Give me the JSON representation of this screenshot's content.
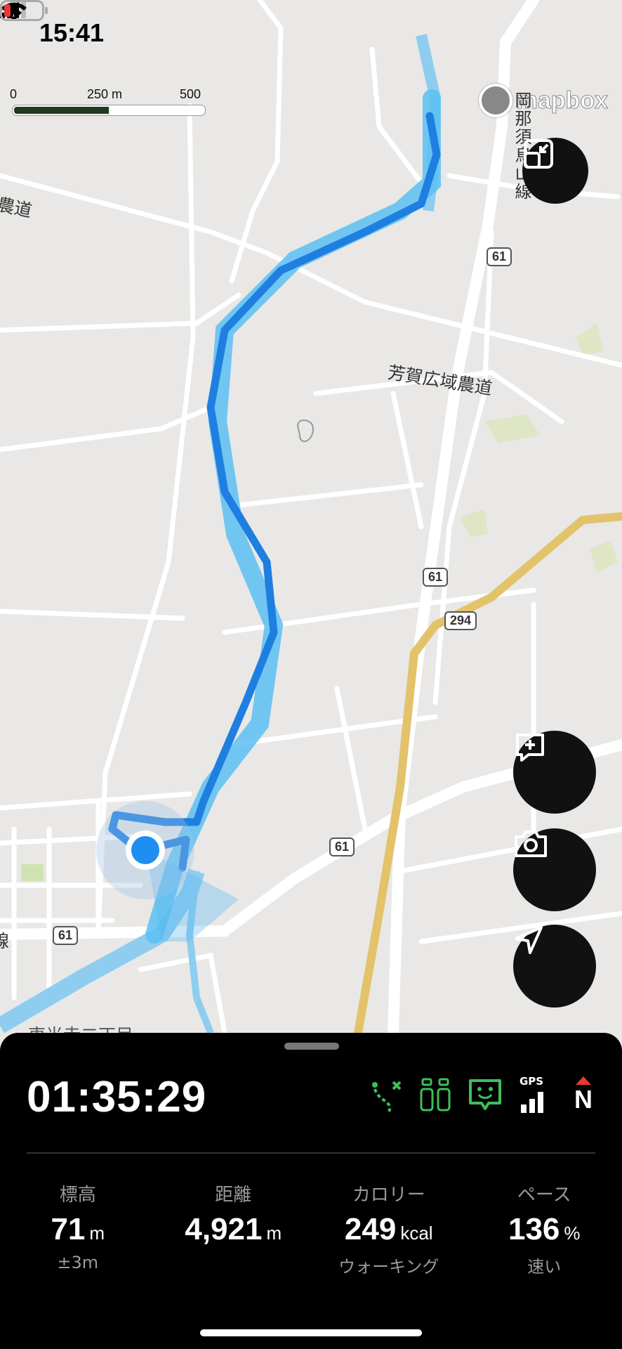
{
  "status_bar": {
    "time": "15:41",
    "battery_color": "#e53935"
  },
  "map": {
    "scale": {
      "labels": [
        "0",
        "250 m",
        "500 m"
      ]
    },
    "attribution": "mapbox",
    "labels": {
      "road_vertical": "岡那須烏山線",
      "road_left": "農道",
      "road_mid": "芳賀広域農道",
      "area_bottom": "東光寺二丁目",
      "left_edge": "線"
    },
    "shields": [
      "61",
      "61",
      "294",
      "61",
      "61"
    ],
    "route_color": "#1e7fe0",
    "highway_color": "#e2c36a"
  },
  "map_buttons": {
    "fit_icon": "fit-route-icon",
    "annotate_icon": "add-memo-icon",
    "camera_icon": "camera-icon",
    "locate_icon": "location-arrow-icon"
  },
  "panel": {
    "elapsed": "01:35:29",
    "status_icons": [
      "route-icon",
      "partner-icon",
      "face-icon",
      "gps-signal-icon",
      "compass-north-icon"
    ],
    "gps_label": "GPS",
    "north_label": "N",
    "stats": [
      {
        "label": "標高",
        "value": "71",
        "unit": "m",
        "sub": "±3m"
      },
      {
        "label": "距離",
        "value": "4,921",
        "unit": "m",
        "sub": ""
      },
      {
        "label": "カロリー",
        "value": "249",
        "unit": "kcal",
        "sub": "ウォーキング"
      },
      {
        "label": "ペース",
        "value": "136",
        "unit": "%",
        "sub": "速い"
      }
    ]
  }
}
